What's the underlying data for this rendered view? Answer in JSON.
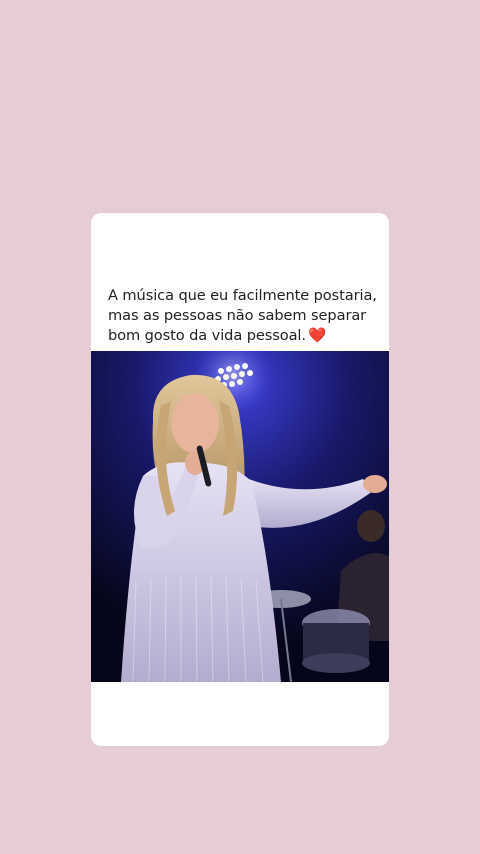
{
  "post": {
    "caption": "A música que eu facilmente postaria, mas as pessoas não sabem separar bom gosto da vida pessoal.",
    "heart_emoji": "❤️"
  },
  "media": {
    "type": "video-frame",
    "subject": "singer-on-stage-with-microphone"
  },
  "colors": {
    "background": "#e6ccd4",
    "card": "#ffffff",
    "text": "#222222",
    "stage": "#0b0b2c"
  }
}
